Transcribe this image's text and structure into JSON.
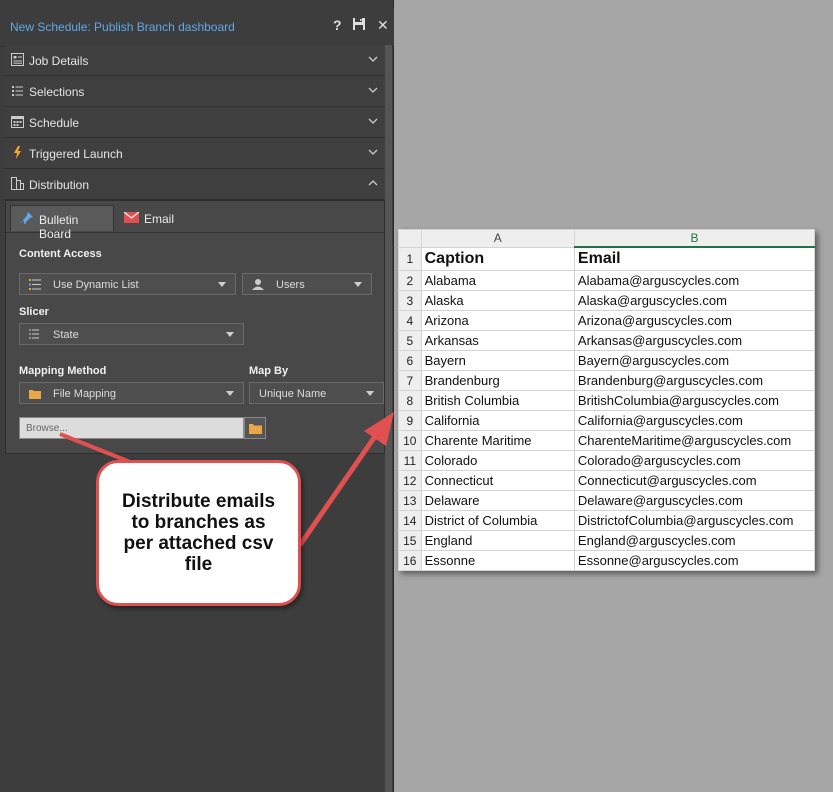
{
  "window": {
    "title": "New Schedule: Publish Branch dashboard",
    "help_label": "?",
    "close_label": "✕"
  },
  "sections": [
    {
      "label": "Job Details",
      "icon": "job-details-icon",
      "expanded": false
    },
    {
      "label": "Selections",
      "icon": "selections-icon",
      "expanded": false
    },
    {
      "label": "Schedule",
      "icon": "calendar-icon",
      "expanded": false
    },
    {
      "label": "Triggered Launch",
      "icon": "lightning-icon",
      "expanded": false
    },
    {
      "label": "Distribution",
      "icon": "distribution-icon",
      "expanded": true
    }
  ],
  "distribution": {
    "tabs": [
      {
        "label": "Bulletin Board",
        "active": true
      },
      {
        "label": "Email",
        "active": false
      }
    ],
    "content_access_label": "Content Access",
    "content_access_value": "Use Dynamic List",
    "users_value": "Users",
    "slicer_label": "Slicer",
    "slicer_value": "State",
    "mapping_method_label": "Mapping Method",
    "mapping_method_value": "File Mapping",
    "map_by_label": "Map By",
    "map_by_value": "Unique Name",
    "browse_placeholder": "Browse..."
  },
  "callout": {
    "text": "Distribute emails\nto branches as\nper attached csv\nfile"
  },
  "spreadsheet": {
    "columns": [
      "A",
      "B"
    ],
    "rows": [
      {
        "n": "1",
        "a": "Caption",
        "b": "Email"
      },
      {
        "n": "2",
        "a": "Alabama",
        "b": "Alabama@arguscycles.com"
      },
      {
        "n": "3",
        "a": "Alaska",
        "b": "Alaska@arguscycles.com"
      },
      {
        "n": "4",
        "a": "Arizona",
        "b": "Arizona@arguscycles.com"
      },
      {
        "n": "5",
        "a": "Arkansas",
        "b": "Arkansas@arguscycles.com"
      },
      {
        "n": "6",
        "a": "Bayern",
        "b": "Bayern@arguscycles.com"
      },
      {
        "n": "7",
        "a": "Brandenburg",
        "b": "Brandenburg@arguscycles.com"
      },
      {
        "n": "8",
        "a": "British Columbia",
        "b": "BritishColumbia@arguscycles.com"
      },
      {
        "n": "9",
        "a": "California",
        "b": "California@arguscycles.com"
      },
      {
        "n": "10",
        "a": "Charente Maritime",
        "b": "CharenteMaritime@arguscycles.com"
      },
      {
        "n": "11",
        "a": "Colorado",
        "b": "Colorado@arguscycles.com"
      },
      {
        "n": "12",
        "a": "Connecticut",
        "b": "Connecticut@arguscycles.com"
      },
      {
        "n": "13",
        "a": "Delaware",
        "b": "Delaware@arguscycles.com"
      },
      {
        "n": "14",
        "a": "District of Columbia",
        "b": "DistrictofColumbia@arguscycles.com"
      },
      {
        "n": "15",
        "a": "England",
        "b": "England@arguscycles.com"
      },
      {
        "n": "16",
        "a": "Essonne",
        "b": "Essonne@arguscycles.com"
      }
    ]
  },
  "colors": {
    "title_blue": "#5fa9e8",
    "panel_bg": "#3d3d3d",
    "callout_red": "#e05050",
    "excel_green": "#217346"
  }
}
